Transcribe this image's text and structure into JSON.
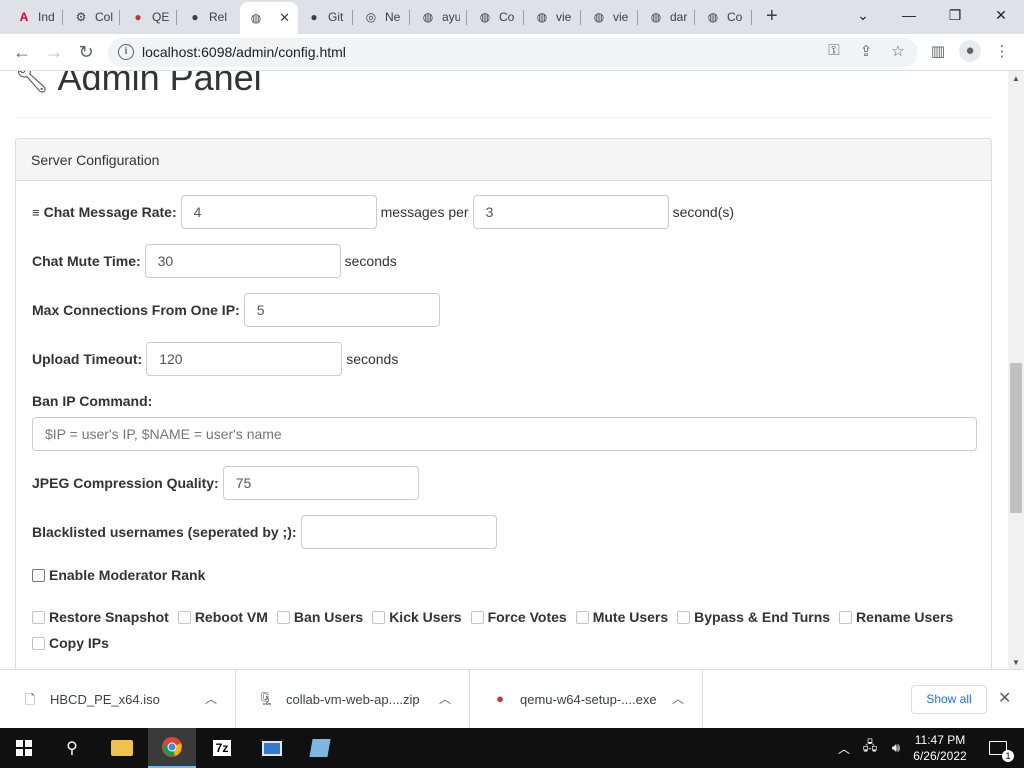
{
  "browser": {
    "tabs": [
      {
        "label": "Ind",
        "icon": "angular-icon"
      },
      {
        "label": "Col",
        "icon": "git-icon"
      },
      {
        "label": "QE",
        "icon": "qemu-icon"
      },
      {
        "label": "Rel",
        "icon": "github-icon"
      },
      {
        "label": "",
        "icon": "globe-icon",
        "active": true
      },
      {
        "label": "Git",
        "icon": "github-icon"
      },
      {
        "label": "Ne",
        "icon": "chrome-icon"
      },
      {
        "label": "ayu",
        "icon": "globe-icon"
      },
      {
        "label": "Co",
        "icon": "globe-icon"
      },
      {
        "label": "vie",
        "icon": "globe-icon"
      },
      {
        "label": "vie",
        "icon": "globe-icon"
      },
      {
        "label": "dar",
        "icon": "globe-icon"
      },
      {
        "label": "Co",
        "icon": "globe-icon"
      }
    ],
    "url": "localhost:6098/admin/config.html"
  },
  "page": {
    "title": "Admin Panel",
    "panel_heading": "Server Configuration",
    "chat_rate": {
      "label": "Chat Message Rate:",
      "messages": "4",
      "middle": "messages per",
      "seconds": "3",
      "suffix": "second(s)"
    },
    "mute_time": {
      "label": "Chat Mute Time:",
      "value": "30",
      "suffix": "seconds"
    },
    "max_conn": {
      "label": "Max Connections From One IP:",
      "value": "5"
    },
    "upload_timeout": {
      "label": "Upload Timeout:",
      "value": "120",
      "suffix": "seconds"
    },
    "ban_ip": {
      "label": "Ban IP Command:",
      "placeholder": "$IP = user's IP, $NAME = user's name"
    },
    "jpeg": {
      "label": "JPEG Compression Quality:",
      "value": "75"
    },
    "blacklist": {
      "label": "Blacklisted usernames (seperated by ;):",
      "value": ""
    },
    "moderator": {
      "label": "Enable Moderator Rank",
      "checked": false
    },
    "permissions": [
      {
        "label": "Restore Snapshot",
        "checked": false
      },
      {
        "label": "Reboot VM",
        "checked": false
      },
      {
        "label": "Ban Users",
        "checked": false
      },
      {
        "label": "Kick Users",
        "checked": false
      },
      {
        "label": "Force Votes",
        "checked": false
      },
      {
        "label": "Mute Users",
        "checked": false
      },
      {
        "label": "Bypass & End Turns",
        "checked": false
      },
      {
        "label": "Rename Users",
        "checked": false
      },
      {
        "label": "Copy IPs",
        "checked": false
      }
    ]
  },
  "downloads": {
    "items": [
      {
        "name": "HBCD_PE_x64.iso",
        "icon": "file-icon"
      },
      {
        "name": "collab-vm-web-ap....zip",
        "icon": "zip-icon"
      },
      {
        "name": "qemu-w64-setup-....exe",
        "icon": "qemu-icon"
      }
    ],
    "show_all": "Show all"
  },
  "taskbar": {
    "time": "11:47 PM",
    "date": "6/26/2022",
    "notification_count": "1"
  }
}
